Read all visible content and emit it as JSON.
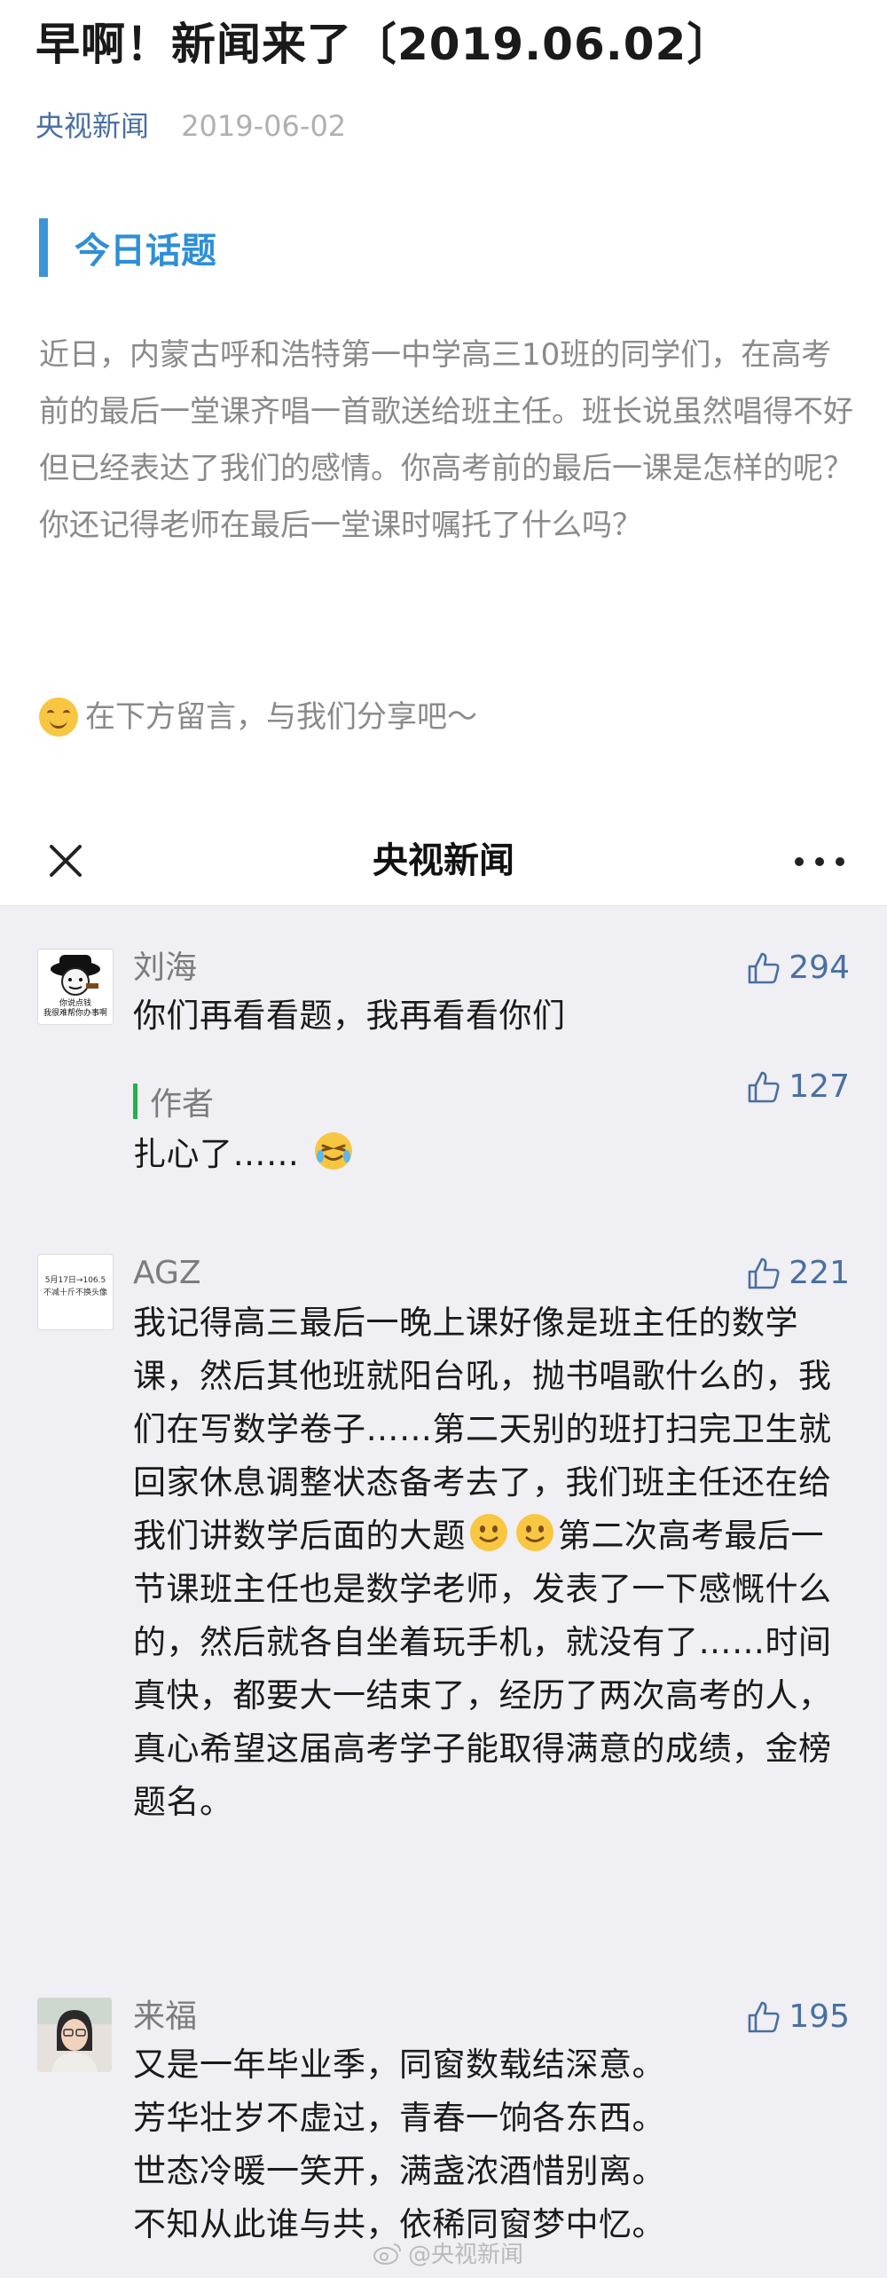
{
  "article": {
    "title": "早啊！新闻来了〔2019.06.02〕",
    "source": "央视新闻",
    "date": "2019-06-02",
    "section_title": "今日话题",
    "intro": "近日，内蒙古呼和浩特第一中学高三10班的同学们，在高考前的最后一堂课齐唱一首歌送给班主任。班长说虽然唱得不好但已经表达了我们的感情。你高考前的最后一课是怎样的呢？你还记得老师在最后一堂课时嘱托了什么吗？",
    "cta": "在下方留言，与我们分享吧～",
    "cta_emoji": "smile-emoji"
  },
  "panel": {
    "title": "央视新闻"
  },
  "comments": [
    {
      "name": "刘海",
      "avatar_text_1": "你说点钱",
      "avatar_text_2": "我很难帮你办事啊",
      "likes": "294",
      "text": "你们再看看题，我再看看你们",
      "reply": {
        "label": "作者",
        "likes": "127",
        "text": "扎心了……"
      }
    },
    {
      "name": "AGZ",
      "avatar_text_1": "5月17日→106.5",
      "avatar_text_2": "不减十斤不换头像",
      "likes": "221",
      "text_part1": "我记得高三最后一晚上课好像是班主任的数学课，然后其他班就阳台吼，抛书唱歌什么的，我们在写数学卷子……第二天别的班打扫完卫生就回家休息调整状态备考去了，我们班主任还在给我们讲数学后面的大题",
      "text_part2": "第二次高考最后一节课班主任也是数学老师，发表了一下感慨什么的，然后就各自坐着玩手机，就没有了……时间真快，都要大一结束了，经历了两次高考的人，真心希望这届高考学子能取得满意的成绩，金榜题名。"
    },
    {
      "name": "来福",
      "likes": "195",
      "lines": [
        "又是一年毕业季，同窗数载结深意。",
        "芳华壮岁不虚过，青春一饷各东西。",
        "世态冷暖一笑开，满盏浓酒惜别离。",
        "不知从此谁与共，依稀同窗梦中忆。"
      ]
    }
  ],
  "watermark": "@央视新闻",
  "colors": {
    "accent_blue": "#3d95d6",
    "link_blue": "#4a6fa1",
    "author_green": "#21b24a",
    "panel_bg": "#efeff4"
  }
}
